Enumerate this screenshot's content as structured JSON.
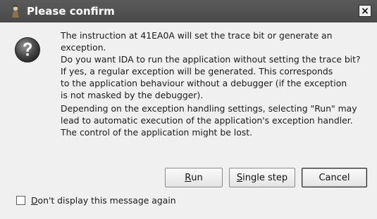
{
  "window": {
    "title": "Please confirm",
    "close_glyph": "×"
  },
  "icons": {
    "app": "ida-app-icon",
    "message": "question-icon",
    "close": "close-icon"
  },
  "message": {
    "paragraph1": [
      "The instruction at 41EA0A will set the trace bit or generate an exception.",
      "Do you want IDA to run the application without setting the trace bit?",
      "If yes, a regular exception will be generated. This corresponds",
      "to the application behaviour without a debugger (if the exception",
      "is not masked by the debugger)."
    ],
    "paragraph2": [
      "Depending on the exception handling settings, selecting \"Run\" may",
      "lead to automatic execution of the application's exception handler.",
      "The control of the application might be lost."
    ]
  },
  "buttons": {
    "run": {
      "mnemonic": "R",
      "rest": "un"
    },
    "single_step": {
      "mnemonic": "S",
      "rest": "ingle step"
    },
    "cancel": {
      "label": "Cancel"
    }
  },
  "checkbox": {
    "mnemonic": "D",
    "rest": "on't display this message again",
    "checked": false
  },
  "colors": {
    "titlebar": "#4f4f4f",
    "dialog_bg": "#f0f0f0",
    "text": "#1a1a1a"
  }
}
